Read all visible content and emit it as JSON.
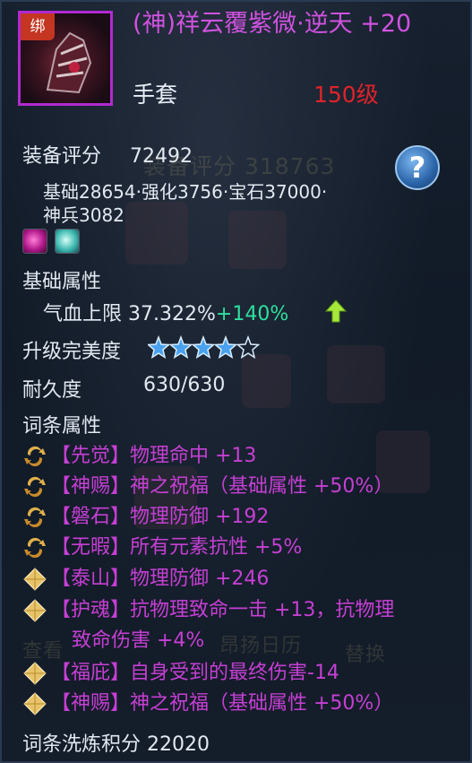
{
  "item": {
    "bind_tag": "绑",
    "name": "(神)祥云覆紫微·逆天 +20",
    "type": "手套",
    "level": "150级",
    "name_color": "#cf52df",
    "level_color": "#e0232a"
  },
  "score": {
    "label": "装备评分",
    "value": "72492",
    "breakdown_line1": "基础28654·强化3756·宝石37000·",
    "breakdown_line2": "神兵3082"
  },
  "background_ghost": {
    "score_text": "装备评分 318763",
    "button_left": "查看",
    "button_mid": "昂扬日历",
    "button_right": "替换"
  },
  "gems": [
    "ruby-gem-icon",
    "aquamarine-gem-icon"
  ],
  "base_attr": {
    "header": "基础属性",
    "stat_label": "气血上限 37.322%",
    "stat_bonus": "+140%",
    "up_icon": "green-up-arrow-icon"
  },
  "perfection": {
    "label": "升级完美度",
    "stars_filled": 4,
    "stars_total": 5
  },
  "durability": {
    "label": "耐久度",
    "value": "630/630"
  },
  "affixes": {
    "header": "词条属性",
    "items": [
      {
        "icon": "refine-swirl-icon",
        "text": "【先觉】物理命中 +13"
      },
      {
        "icon": "refine-swirl-icon",
        "text": "【神赐】神之祝福（基础属性 +50%）"
      },
      {
        "icon": "refine-swirl-icon",
        "text": "【磐石】物理防御 +192"
      },
      {
        "icon": "refine-swirl-icon",
        "text": "【无暇】所有元素抗性 +5%"
      },
      {
        "icon": "gold-diamond-icon",
        "text": "【泰山】物理防御 +246"
      },
      {
        "icon": "gold-diamond-icon",
        "text": "【护魂】抗物理致命一击 +13，抗物理",
        "text2": "致命伤害 +4%"
      },
      {
        "icon": "gold-diamond-icon",
        "text": "【福庇】自身受到的最终伤害-14"
      },
      {
        "icon": "gold-diamond-icon",
        "text": "【神赐】神之祝福（基础属性 +50%）"
      }
    ]
  },
  "refine_points": {
    "label": "词条洗炼积分",
    "value": "22020"
  },
  "help": {
    "label": "?"
  }
}
